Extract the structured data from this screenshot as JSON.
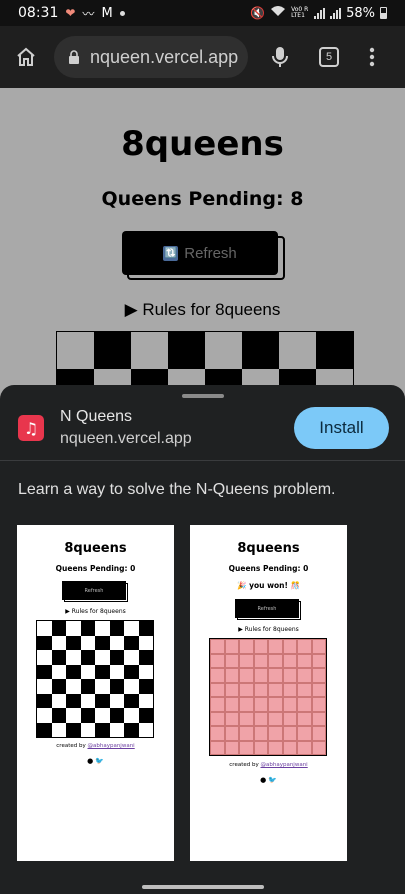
{
  "status_bar": {
    "time": "08:31",
    "network": "Vo0 R LTE1",
    "battery": "58%"
  },
  "browser": {
    "url": "nqueen.vercel.app",
    "tab_count": "5",
    "icons": [
      "home-icon",
      "lock-icon",
      "mic-icon",
      "tab-switcher-icon",
      "more-vert-icon"
    ]
  },
  "page": {
    "title": "8queens",
    "pending": "Queens Pending: 8",
    "refresh_label": "Refresh",
    "rules_label": "▶ Rules for 8queens"
  },
  "install_sheet": {
    "app_name": "N Queens",
    "app_url": "nqueen.vercel.app",
    "install_label": "Install",
    "description": "Learn a way to solve the N-Queens problem.",
    "screenshots": [
      {
        "title": "8queens",
        "pending": "Queens Pending: 0",
        "refresh_label": "Refresh",
        "rules_label": "▶ Rules for 8queens",
        "credit_prefix": "created by",
        "credit_handle": "@abhaypanjwani"
      },
      {
        "title": "8queens",
        "pending": "Queens Pending: 0",
        "won_label": "🎉 you won! 🎊",
        "refresh_label": "Refresh",
        "rules_label": "▶ Rules for 8queens",
        "credit_prefix": "created by",
        "credit_handle": "@abhaypanjwani"
      }
    ]
  },
  "colors": {
    "install_button": "#7cc9f8",
    "app_icon": "#e8364d",
    "sheet_bg": "#1f2122",
    "solved_board": "#f0a3a8"
  }
}
